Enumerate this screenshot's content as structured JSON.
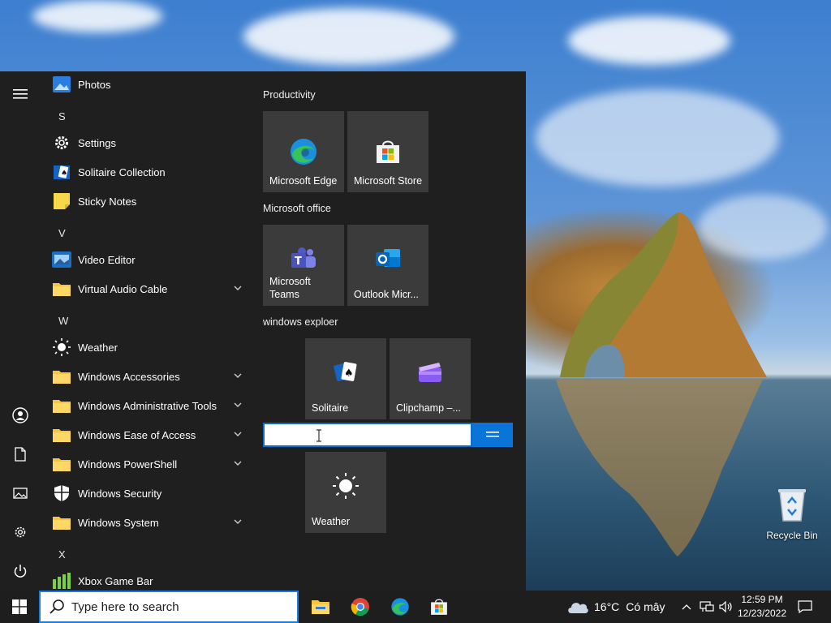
{
  "desktop": {
    "recycle_bin_label": "Recycle Bin"
  },
  "start_menu": {
    "rail_icons": [
      "hamburger-icon",
      "user-icon",
      "document-icon",
      "pictures-icon",
      "settings-icon",
      "power-icon"
    ],
    "apps": [
      {
        "label": "Photos",
        "icon": "photos-icon"
      },
      {
        "letter": "S"
      },
      {
        "label": "Settings",
        "icon": "gear-icon"
      },
      {
        "label": "Solitaire Collection",
        "icon": "solitaire-icon"
      },
      {
        "label": "Sticky Notes",
        "icon": "sticky-notes-icon"
      },
      {
        "letter": "V"
      },
      {
        "label": "Video Editor",
        "icon": "video-editor-icon"
      },
      {
        "label": "Virtual Audio Cable",
        "icon": "folder-icon",
        "expandable": true
      },
      {
        "letter": "W"
      },
      {
        "label": "Weather",
        "icon": "sun-icon"
      },
      {
        "label": "Windows Accessories",
        "icon": "folder-icon",
        "expandable": true
      },
      {
        "label": "Windows Administrative Tools",
        "icon": "folder-icon",
        "expandable": true
      },
      {
        "label": "Windows Ease of Access",
        "icon": "folder-icon",
        "expandable": true
      },
      {
        "label": "Windows PowerShell",
        "icon": "folder-icon",
        "expandable": true
      },
      {
        "label": "Windows Security",
        "icon": "shield-icon"
      },
      {
        "label": "Windows System",
        "icon": "folder-icon",
        "expandable": true
      },
      {
        "letter": "X"
      },
      {
        "label": "Xbox Game Bar",
        "icon": "xbox-game-bar-icon"
      }
    ],
    "groups": {
      "productivity": "Productivity",
      "office": "Microsoft office",
      "explorer": "windows  exploer"
    },
    "tiles": {
      "edge": "Microsoft Edge",
      "store": "Microsoft Store",
      "teams": "Microsoft Teams",
      "outlook": "Outlook Micr...",
      "solitaire": "Solitaire",
      "clipchamp": "Clipchamp –...",
      "weather": "Weather"
    },
    "group_name_input": {
      "value": ""
    }
  },
  "taskbar": {
    "search_placeholder": "Type here to search",
    "pinned": [
      "file-explorer-icon",
      "chrome-icon",
      "edge-icon",
      "store-icon"
    ],
    "weather_temp": "16°C",
    "weather_desc": "Có mây",
    "time": "12:59 PM",
    "date": "12/23/2022"
  },
  "colors": {
    "accent": "#0a74d8",
    "start_bg": "#1f1f1f",
    "tile_bg": "#3b3b3b",
    "folder": "#f5c542"
  }
}
